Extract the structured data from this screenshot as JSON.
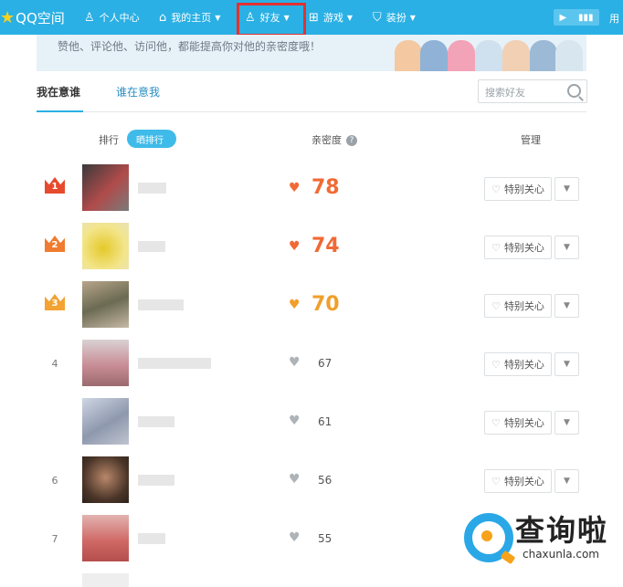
{
  "nav": {
    "logo": "QQ空间",
    "items": [
      {
        "label": "个人中心",
        "icon": "person-icon"
      },
      {
        "label": "我的主页",
        "icon": "home-icon"
      },
      {
        "label": "好友",
        "icon": "friends-icon"
      },
      {
        "label": "游戏",
        "icon": "grid-icon"
      },
      {
        "label": "装扮",
        "icon": "shirt-icon"
      }
    ],
    "user_label": "用"
  },
  "banner": {
    "text": "赞他、评论他、访问他，都能提高你对他的亲密度哦！"
  },
  "tabs": {
    "active": "我在意谁",
    "other": "谁在意我"
  },
  "search": {
    "placeholder": "搜索好友"
  },
  "header": {
    "rank": "排行",
    "toggle": "晒排行",
    "intimacy": "亲密度",
    "manage": "管理"
  },
  "friends": [
    {
      "rank": "1",
      "score": "78"
    },
    {
      "rank": "2",
      "score": "74"
    },
    {
      "rank": "3",
      "score": "70"
    },
    {
      "rank": "4",
      "score": "67"
    },
    {
      "rank": "",
      "score": "61"
    },
    {
      "rank": "6",
      "score": "56"
    },
    {
      "rank": "7",
      "score": "55"
    }
  ],
  "actions": {
    "care": "特别关心"
  },
  "watermark": {
    "title": "查询啦",
    "url": "chaxunla.com"
  },
  "colors": {
    "nav": "#2ab0e4",
    "top_score": "#f06a35",
    "highlight": "#e03232"
  }
}
